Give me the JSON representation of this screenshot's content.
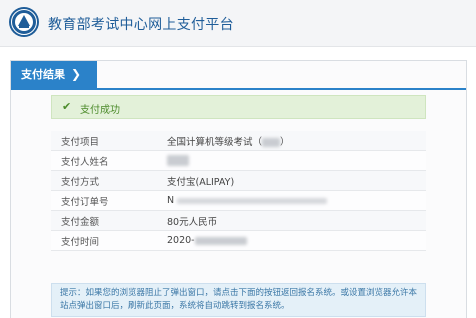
{
  "header": {
    "site_title": "教育部考试中心网上支付平台",
    "logo_icon": "ministry-seal-icon"
  },
  "tab": {
    "label": "支付结果",
    "chevron": "❯",
    "color": "#2b82c9"
  },
  "status": {
    "icon": "✔",
    "text": "支付成功",
    "color": "#4c8b2b"
  },
  "details": [
    {
      "label": "支付项目",
      "value": "全国计算机等级考试（",
      "suffix": "）"
    },
    {
      "label": "支付人姓名",
      "value": ""
    },
    {
      "label": "支付方式",
      "value": "支付宝(ALIPAY)"
    },
    {
      "label": "支付订单号",
      "value": "N"
    },
    {
      "label": "支付金额",
      "value": "80元人民币"
    },
    {
      "label": "支付时间",
      "value": "2020-"
    }
  ],
  "tip": {
    "text": "提示：如果您的浏览器阻止了弹出窗口，请点击下面的按钮返回报名系统。或设置浏览器允许本站点弹出窗口后，刷新此页面，系统将自动跳转到报名系统。"
  }
}
